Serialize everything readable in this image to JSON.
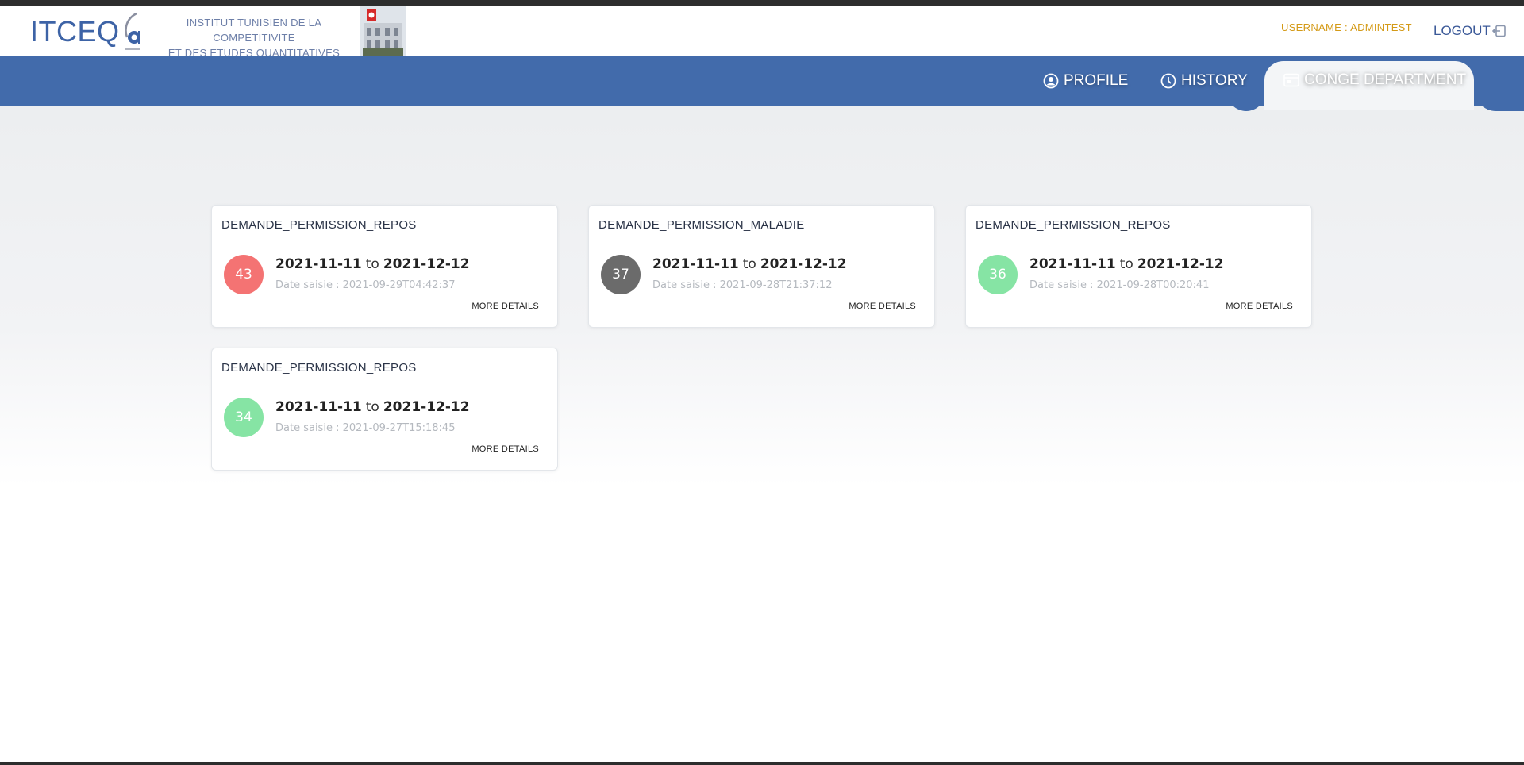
{
  "header": {
    "brand": "ITCEQ",
    "institute_line1": "INSTITUT TUNISIEN DE LA COMPETITIVITE",
    "institute_line2": "ET DES ETUDES QUANTITATIVES",
    "username": "USERNAME : ADMINTEST",
    "logout": "LOGOUT",
    "brand_color": "#3d63a6"
  },
  "nav": {
    "profile": "PROFILE",
    "history": "HISTORY",
    "conge": "CONGE DEPARTMENT",
    "bar_color": "#426bab"
  },
  "cards": [
    {
      "title": "DEMANDE_PERMISSION_REPOS",
      "badge": "43",
      "badge_color": "#f47373",
      "date_from": "2021-11-11",
      "to": "to",
      "date_to": "2021-12-12",
      "saisie": "Date saisie : 2021-09-29T04:42:37",
      "more": "MORE DETAILS"
    },
    {
      "title": "DEMANDE_PERMISSION_MALADIE",
      "badge": "37",
      "badge_color": "#6b6b6b",
      "date_from": "2021-11-11",
      "to": "to",
      "date_to": "2021-12-12",
      "saisie": "Date saisie : 2021-09-28T21:37:12",
      "more": "MORE DETAILS"
    },
    {
      "title": "DEMANDE_PERMISSION_REPOS",
      "badge": "36",
      "badge_color": "#86e4a4",
      "date_from": "2021-11-11",
      "to": "to",
      "date_to": "2021-12-12",
      "saisie": "Date saisie : 2021-09-28T00:20:41",
      "more": "MORE DETAILS"
    },
    {
      "title": "DEMANDE_PERMISSION_REPOS",
      "badge": "34",
      "badge_color": "#86e4a4",
      "date_from": "2021-11-11",
      "to": "to",
      "date_to": "2021-12-12",
      "saisie": "Date saisie : 2021-09-27T15:18:45",
      "more": "MORE DETAILS"
    }
  ]
}
